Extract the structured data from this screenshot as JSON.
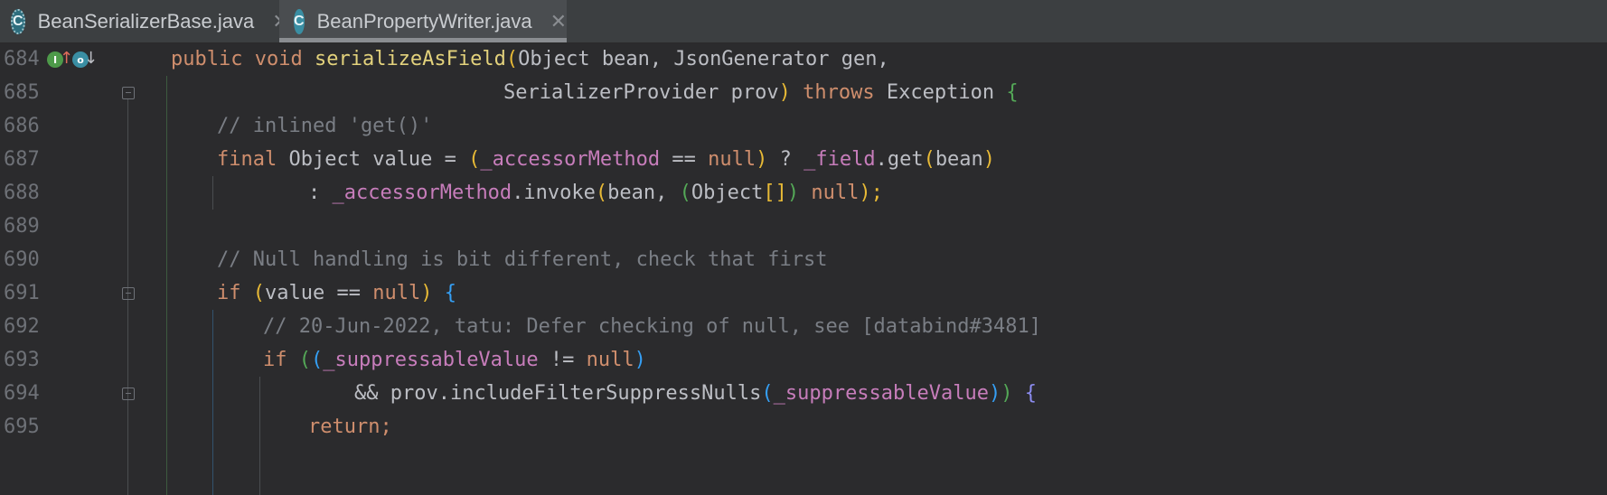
{
  "tabs": [
    {
      "label": "BeanSerializerBase.java",
      "icon": "java-class-icon",
      "icon_glyph": "C",
      "active": false,
      "close_glyph": "✕"
    },
    {
      "label": "BeanPropertyWriter.java",
      "icon": "java-class-icon",
      "icon_glyph": "C",
      "active": true,
      "close_glyph": "✕"
    }
  ],
  "gutter_markers": {
    "overrides_marker_glyph": "I",
    "overridden_marker_glyph": "o",
    "up_arrow": "↑",
    "down_arrow": "↓"
  },
  "lines": [
    {
      "number": "684"
    },
    {
      "number": "685"
    },
    {
      "number": "686"
    },
    {
      "number": "687"
    },
    {
      "number": "688"
    },
    {
      "number": "689"
    },
    {
      "number": "690"
    },
    {
      "number": "691"
    },
    {
      "number": "692"
    },
    {
      "number": "693"
    },
    {
      "number": "694"
    },
    {
      "number": "695"
    }
  ],
  "code": {
    "l684": {
      "t1": "public",
      "t2": "void",
      "t3": "serializeAsField",
      "t4": "(",
      "t5": "Object bean, JsonGenerator gen,"
    },
    "l685": {
      "t1": "SerializerProvider prov",
      "t2": ")",
      "t3": "throws",
      "t4": "Exception",
      "t5": "{"
    },
    "l686": {
      "t1": "// inlined 'get()'"
    },
    "l687": {
      "t1": "final",
      "t2": "Object value =",
      "t3": "(",
      "t4": "_accessorMethod",
      "t5": "==",
      "t6": "null",
      "t7": ")",
      "t8": "?",
      "t9": "_field",
      "t10": ".get",
      "t11": "(",
      "t12": "bean",
      "t13": ")"
    },
    "l688": {
      "t1": ":",
      "t2": "_accessorMethod",
      "t3": ".invoke",
      "t4": "(",
      "t5": "bean,",
      "t6": "(",
      "t7": "Object",
      "t8": "[]",
      "t9": ")",
      "t10": "null",
      "t11": ");"
    },
    "l690": {
      "t1": "// Null handling is bit different, check that first"
    },
    "l691": {
      "t1": "if",
      "t2": "(",
      "t3": "value ==",
      "t4": "null",
      "t5": ")",
      "t6": "{"
    },
    "l692": {
      "t1": "// 20-Jun-2022, tatu: Defer checking of null, see [databind#3481]"
    },
    "l693": {
      "t1": "if",
      "t2": "(",
      "t3": "(",
      "t4": "_suppressableValue",
      "t5": "!=",
      "t6": "null",
      "t7": ")"
    },
    "l694": {
      "t1": "&& prov.includeFilterSuppressNulls",
      "t2": "(",
      "t3": "_suppressableValue",
      "t4": ")",
      "t5": ")",
      "t6": "{"
    },
    "l695": {
      "t1": "return;"
    }
  }
}
